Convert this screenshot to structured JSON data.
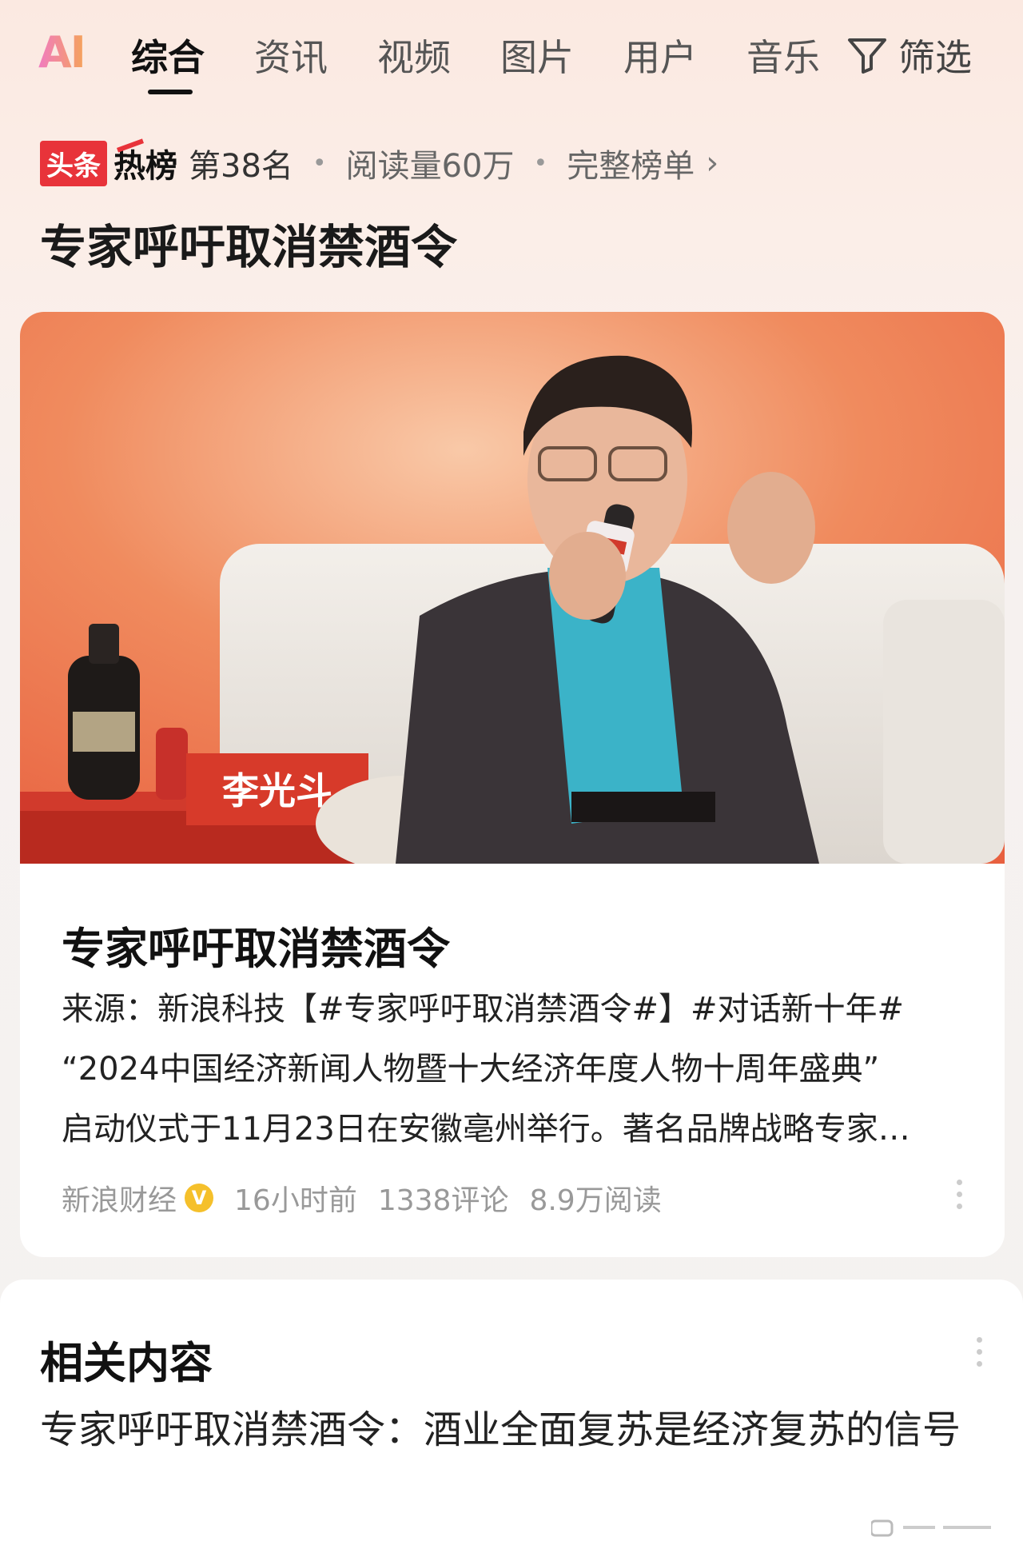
{
  "top_nav": {
    "logo": "AI",
    "tabs": [
      {
        "label": "综合",
        "active": true
      },
      {
        "label": "资讯",
        "active": false
      },
      {
        "label": "视频",
        "active": false
      },
      {
        "label": "图片",
        "active": false
      },
      {
        "label": "用户",
        "active": false
      },
      {
        "label": "音乐",
        "active": false
      }
    ],
    "filter_label": "筛选"
  },
  "hot_rank": {
    "brand": "头条",
    "list_name": "热榜",
    "rank": "第38名",
    "reads": "阅读量60万",
    "full_list": "完整榜单"
  },
  "topic_title": "专家呼吁取消禁酒令",
  "article": {
    "image_caption_tag": "李光斗",
    "title": "专家呼吁取消禁酒令",
    "summary_lines": [
      "来源：新浪科技【#专家呼吁取消禁酒令#】#对话新十年#",
      "“2024中国经济新闻人物暨十大经济年度人物十周年盛典”",
      "启动仪式于11月23日在安徽亳州举行。著名品牌战略专家…"
    ],
    "source": "新浪财经",
    "verified_badge": "V",
    "time": "16小时前",
    "comments": "1338评论",
    "reads": "8.9万阅读"
  },
  "related": {
    "title": "相关内容",
    "items": [
      {
        "text": "专家呼吁取消禁酒令：酒业全面复苏是经济复苏的信号"
      }
    ]
  },
  "colors": {
    "accent_red": "#e8333a",
    "verified_yellow": "#f5c02b"
  }
}
